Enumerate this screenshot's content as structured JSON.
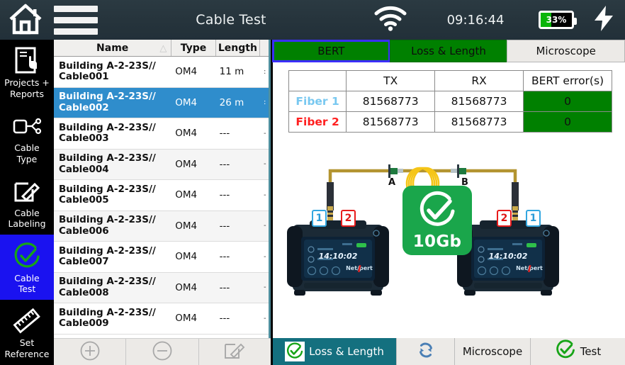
{
  "topbar": {
    "home_icon": "home-icon",
    "menu_icon": "hamburger-menu-icon",
    "title": "Cable Test",
    "wifi_icon": "wifi-icon",
    "clock": "09:16:44",
    "battery_percent": "33%",
    "battery_level": 33,
    "charging_icon": "lightning-bolt-icon"
  },
  "sidebar": {
    "items": [
      {
        "label_line1": "Projects +",
        "label_line2": "Reports",
        "icon": "projects-reports-icon",
        "active": false
      },
      {
        "label_line1": "Cable",
        "label_line2": "Type",
        "icon": "cable-type-icon",
        "active": false
      },
      {
        "label_line1": "Cable",
        "label_line2": "Labeling",
        "icon": "cable-labeling-icon",
        "active": false
      },
      {
        "label_line1": "Cable",
        "label_line2": "Test",
        "icon": "check-circle-icon",
        "active": true
      },
      {
        "label_line1": "Set",
        "label_line2": "Reference",
        "icon": "ruler-icon",
        "active": false
      }
    ],
    "active_color": "#1a12f0"
  },
  "cable_table": {
    "columns": [
      "Name",
      "Type",
      "Length",
      ""
    ],
    "sort_column": "Name",
    "sort_direction": "ascending",
    "rows": [
      {
        "name_line1": "Building A-2-23S//",
        "name_line2": "Cable001",
        "type": "OM4",
        "length": "11 m",
        "extra": ":",
        "selected": false
      },
      {
        "name_line1": "Building A-2-23S//",
        "name_line2": "Cable002",
        "type": "OM4",
        "length": "26 m",
        "extra": ":",
        "selected": true
      },
      {
        "name_line1": "Building A-2-23S//",
        "name_line2": "Cable003",
        "type": "OM4",
        "length": "---",
        "extra": "-",
        "selected": false
      },
      {
        "name_line1": "Building A-2-23S//",
        "name_line2": "Cable004",
        "type": "OM4",
        "length": "---",
        "extra": "-",
        "selected": false
      },
      {
        "name_line1": "Building A-2-23S//",
        "name_line2": "Cable005",
        "type": "OM4",
        "length": "---",
        "extra": "-",
        "selected": false
      },
      {
        "name_line1": "Building A-2-23S//",
        "name_line2": "Cable006",
        "type": "OM4",
        "length": "---",
        "extra": "-",
        "selected": false
      },
      {
        "name_line1": "Building A-2-23S//",
        "name_line2": "Cable007",
        "type": "OM4",
        "length": "---",
        "extra": "-",
        "selected": false
      },
      {
        "name_line1": "Building A-2-23S//",
        "name_line2": "Cable008",
        "type": "OM4",
        "length": "---",
        "extra": "-",
        "selected": false
      },
      {
        "name_line1": "Building A-2-23S//",
        "name_line2": "Cable009",
        "type": "OM4",
        "length": "---",
        "extra": "-",
        "selected": false
      }
    ],
    "selected_row_color": "#2f8dcc"
  },
  "tabs": [
    {
      "label": "BERT",
      "state": "active-focused",
      "color": "#008000"
    },
    {
      "label": "Loss & Length",
      "state": "passed",
      "color": "#008000"
    },
    {
      "label": "Microscope",
      "state": "inactive",
      "color": "#eceae7"
    }
  ],
  "bert": {
    "headers": [
      "",
      "TX",
      "RX",
      "BERT error(s)"
    ],
    "rows": [
      {
        "fiber": "Fiber 1",
        "fiber_color": "#78c8f0",
        "tx": "81568773",
        "rx": "81568773",
        "errors": "0",
        "errors_color": "#008000"
      },
      {
        "fiber": "Fiber 2",
        "fiber_color": "#ff2020",
        "tx": "81568773",
        "rx": "81568773",
        "errors": "0",
        "errors_color": "#008000"
      }
    ]
  },
  "diagram": {
    "connector_a_label": "A",
    "connector_b_label": "B",
    "left_device": {
      "port_left": "1",
      "port_right": "2",
      "screen_time": "14:10:02",
      "brand": "NetXpert"
    },
    "right_device": {
      "port_left": "2",
      "port_right": "1",
      "screen_time": "14:10:02",
      "brand": "NetXpert"
    },
    "result_badge": {
      "label": "10Gb",
      "icon": "check-circle-icon",
      "color": "#1aa64b"
    }
  },
  "bottom_left_toolbar": [
    {
      "icon": "plus-circle-icon",
      "name": "add-cable-button",
      "enabled": false
    },
    {
      "icon": "minus-circle-icon",
      "name": "remove-cable-button",
      "enabled": false
    },
    {
      "icon": "edit-pencil-icon",
      "name": "edit-cable-button",
      "enabled": false
    }
  ],
  "bottom_right_toolbar": [
    {
      "label": "Loss & Length",
      "icon": "check-circle-icon",
      "active": true,
      "color": "#14707f"
    },
    {
      "label": "",
      "icon": "sync-refresh-icon",
      "active": false
    },
    {
      "label": "Microscope",
      "icon": "",
      "active": false
    },
    {
      "label": "Test",
      "icon": "check-circle-icon",
      "active": false
    }
  ]
}
